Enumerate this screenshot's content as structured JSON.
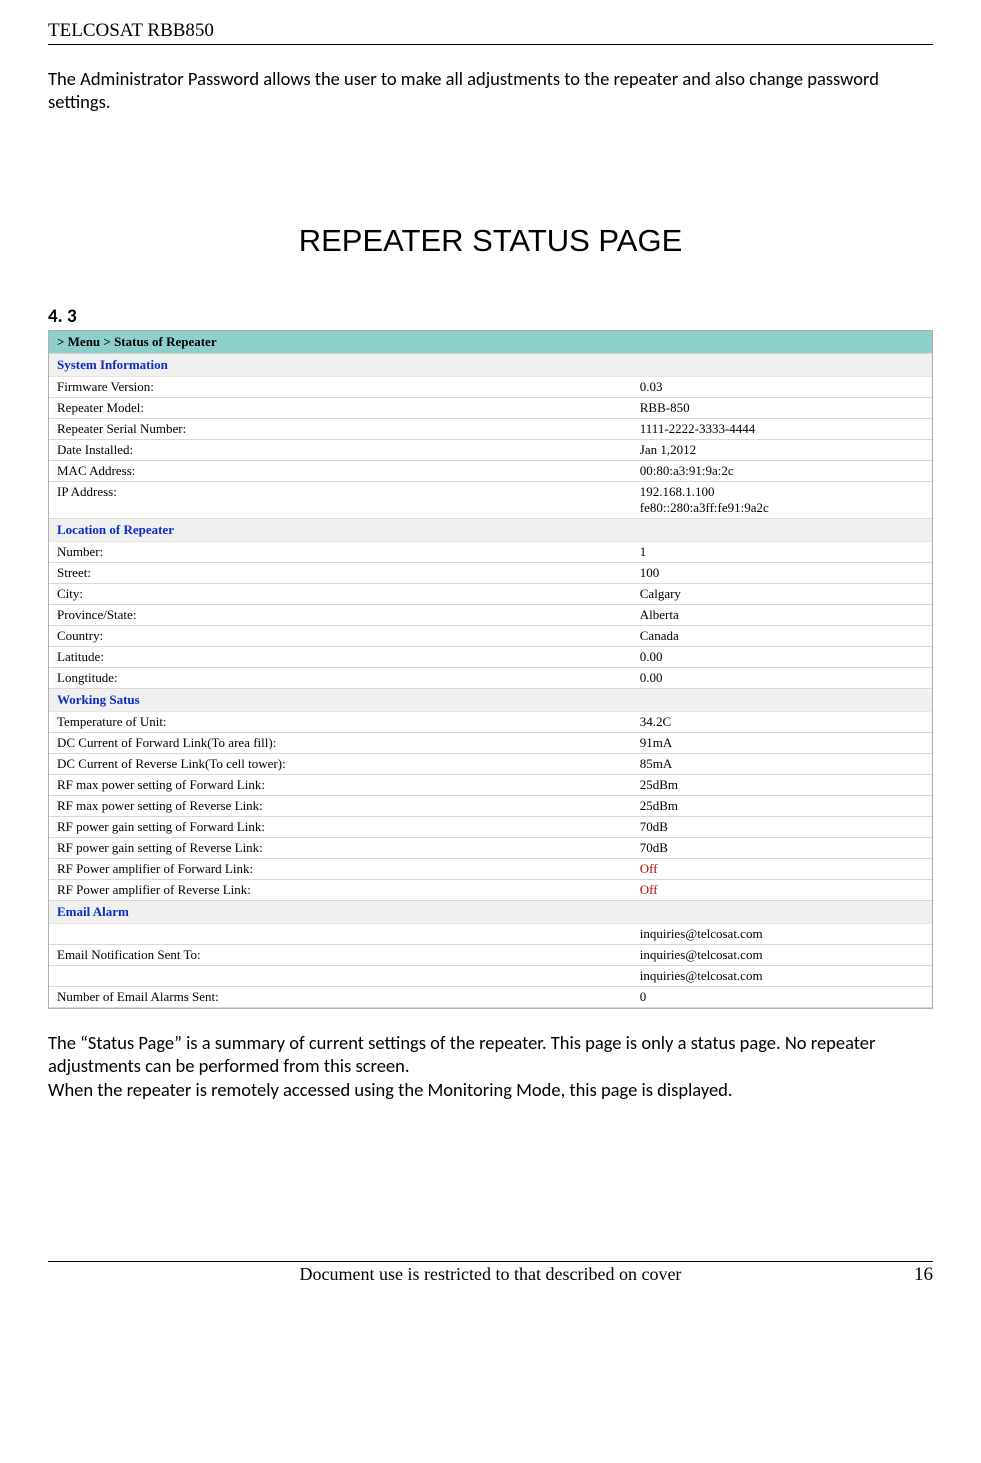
{
  "header": {
    "product": "TELCOSAT RBB850"
  },
  "intro_text": "The Administrator Password allows the user to make all adjustments to the repeater and also change password settings.",
  "big_title": "REPEATER STATUS PAGE",
  "section_num": "4. 3",
  "screenshot": {
    "breadcrumb": "> Menu > Status of Repeater",
    "sections": [
      {
        "title": "System Information",
        "rows": [
          {
            "label": "Firmware Version:",
            "value": "0.03"
          },
          {
            "label": "Repeater Model:",
            "value": "RBB-850"
          },
          {
            "label": "Repeater Serial Number:",
            "value": "1111-2222-3333-4444"
          },
          {
            "label": "Date Installed:",
            "value": "Jan 1,2012"
          },
          {
            "label": "MAC Address:",
            "value": "00:80:a3:91:9a:2c"
          },
          {
            "label": "IP Address:",
            "value": "192.168.1.100\nfe80::280:a3ff:fe91:9a2c"
          }
        ]
      },
      {
        "title": "Location of Repeater",
        "rows": [
          {
            "label": "Number:",
            "value": "1"
          },
          {
            "label": "Street:",
            "value": "100"
          },
          {
            "label": "City:",
            "value": "Calgary"
          },
          {
            "label": "Province/State:",
            "value": "Alberta"
          },
          {
            "label": "Country:",
            "value": "Canada"
          },
          {
            "label": "Latitude:",
            "value": "0.00"
          },
          {
            "label": "Longtitude:",
            "value": "0.00"
          }
        ]
      },
      {
        "title": "Working Satus",
        "rows": [
          {
            "label": "Temperature of Unit:",
            "value": "34.2C"
          },
          {
            "label": "DC Current of Forward Link(To area  fill):",
            "value": "91mA"
          },
          {
            "label": "DC Current of Reverse Link(To cell tower):",
            "value": "85mA"
          },
          {
            "label": "RF max power setting of Forward Link:",
            "value": "25dBm"
          },
          {
            "label": "RF max power setting of Reverse Link:",
            "value": "25dBm"
          },
          {
            "label": "RF power gain setting of Forward Link:",
            "value": "70dB"
          },
          {
            "label": "RF power gain setting of Reverse Link:",
            "value": "70dB"
          },
          {
            "label": "RF Power amplifier of Forward Link:",
            "value": "Off",
            "red": true
          },
          {
            "label": "RF Power amplifier of Reverse Link:",
            "value": "Off",
            "red": true
          }
        ]
      },
      {
        "title": "Email Alarm",
        "rows": [
          {
            "label": "Email Notification Sent To:",
            "value": "inquiries@telcosat.com\ninquiries@telcosat.com\ninquiries@telcosat.com",
            "multiline_email": true
          },
          {
            "label": "Number of Email Alarms Sent:",
            "value": "0"
          }
        ]
      }
    ]
  },
  "body2_p1": "The “Status Page” is a summary of current settings of the repeater. This page is only a status page. No repeater adjustments can be performed from this screen.",
  "body2_p2": "When the repeater is remotely accessed using the Monitoring Mode, this page is displayed.",
  "footer": {
    "center": "Document use is restricted to that described on cover",
    "pagenum": "16"
  }
}
